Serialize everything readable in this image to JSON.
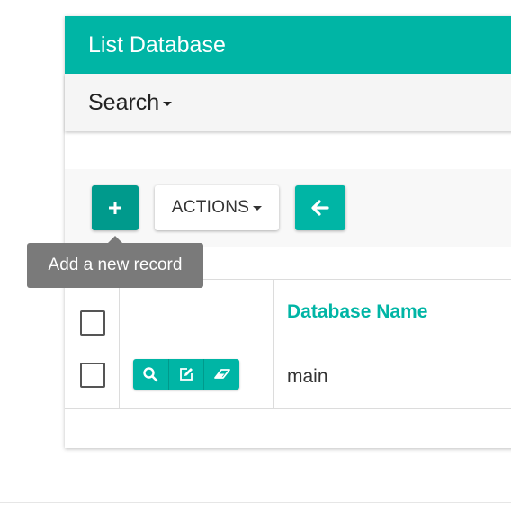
{
  "header": {
    "title": "List Database"
  },
  "search": {
    "label": "Search"
  },
  "toolbar": {
    "add_icon": "plus-icon",
    "actions_label": "ACTIONS",
    "back_icon": "arrow-left-icon"
  },
  "tooltip": {
    "text": "Add a new record"
  },
  "table": {
    "columns": [
      "",
      "",
      "Database Name"
    ],
    "rows": [
      {
        "database_name": "main",
        "actions": [
          "view-icon",
          "edit-icon",
          "delete-icon"
        ]
      }
    ]
  },
  "colors": {
    "accent": "#00b5a5",
    "accent_dark": "#009a8c",
    "tooltip": "#7a7a7a"
  }
}
